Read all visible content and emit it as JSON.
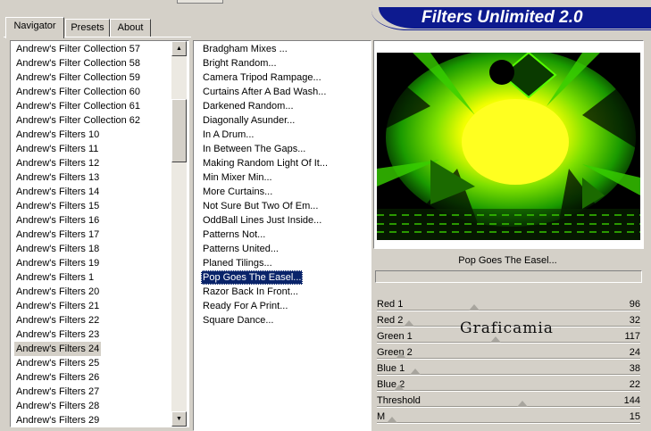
{
  "app": {
    "title": "Filters Unlimited 2.0"
  },
  "tabs": [
    {
      "label": "Navigator",
      "active": true
    },
    {
      "label": "Presets",
      "active": false
    },
    {
      "label": "About",
      "active": false
    }
  ],
  "categories": {
    "items": [
      "Andrew's Filter Collection 57",
      "Andrew's Filter Collection 58",
      "Andrew's Filter Collection 59",
      "Andrew's Filter Collection 60",
      "Andrew's Filter Collection 61",
      "Andrew's Filter Collection 62",
      "Andrew's Filters 10",
      "Andrew's Filters 11",
      "Andrew's Filters 12",
      "Andrew's Filters 13",
      "Andrew's Filters 14",
      "Andrew's Filters 15",
      "Andrew's Filters 16",
      "Andrew's Filters 17",
      "Andrew's Filters 18",
      "Andrew's Filters 19",
      "Andrew's Filters 1",
      "Andrew's Filters 20",
      "Andrew's Filters 21",
      "Andrew's Filters 22",
      "Andrew's Filters 23",
      "Andrew's Filters 24",
      "Andrew's Filters 25",
      "Andrew's Filters 26",
      "Andrew's Filters 27",
      "Andrew's Filters 28",
      "Andrew's Filters 29"
    ],
    "selected": "Andrew's Filters 24"
  },
  "filters": {
    "items": [
      "Bradgham Mixes ...",
      "Bright Random...",
      "Camera Tripod Rampage...",
      "Curtains After A Bad Wash...",
      "Darkened Random...",
      "Diagonally Asunder...",
      "In A Drum...",
      "In Between The Gaps...",
      "Making Random Light Of It...",
      "Min Mixer Min...",
      "More Curtains...",
      "Not Sure But Two Of Em...",
      "OddBall Lines Just Inside...",
      "Patterns Not...",
      "Patterns United...",
      "Planed Tilings...",
      "Pop Goes The Easel...",
      "Razor Back In Front...",
      "Ready For A Print...",
      "Square Dance..."
    ],
    "selected": "Pop Goes The Easel..."
  },
  "preview": {
    "filter_name": "Pop Goes The Easel..."
  },
  "sliders": [
    {
      "label": "Red 1",
      "value": "96",
      "fraction": 0.376
    },
    {
      "label": "Red 2",
      "value": "32",
      "fraction": 0.125
    },
    {
      "label": "Green 1",
      "value": "117",
      "fraction": 0.459
    },
    {
      "label": "Green 2",
      "value": "24",
      "fraction": 0.094
    },
    {
      "label": "Blue 1",
      "value": "38",
      "fraction": 0.149
    },
    {
      "label": "Blue 2",
      "value": "22",
      "fraction": 0.086
    },
    {
      "label": "Threshold",
      "value": "144",
      "fraction": 0.565
    },
    {
      "label": "M",
      "value": "15",
      "fraction": 0.059
    }
  ],
  "watermark": "Graficamia",
  "icons": {
    "scroll_up": "scroll-up-arrow-icon",
    "scroll_down": "scroll-down-arrow-icon"
  },
  "colors": {
    "banner": "#0d1a8f",
    "selection": "#0a246a",
    "face": "#d4d0c8"
  }
}
